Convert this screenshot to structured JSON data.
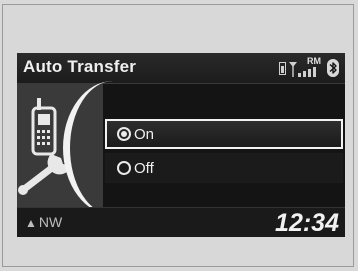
{
  "header": {
    "title": "Auto Transfer",
    "roaming_label": "RM",
    "icons": [
      "phone-battery-icon",
      "signal-strength-icon",
      "bluetooth-icon"
    ]
  },
  "panel": {
    "icons": [
      "cell-phone-icon",
      "wrench-icon"
    ]
  },
  "options": [
    {
      "label": "On",
      "selected": true
    },
    {
      "label": "Off",
      "selected": false
    }
  ],
  "footer": {
    "compass_icon": "compass-arrow-icon",
    "compass": "NW",
    "clock": "12:34"
  },
  "colors": {
    "screen_bg": "#141414",
    "panel_bg": "#3a3a3a",
    "text": "#f0f0f0",
    "page_bg": "#d9d9d9"
  }
}
